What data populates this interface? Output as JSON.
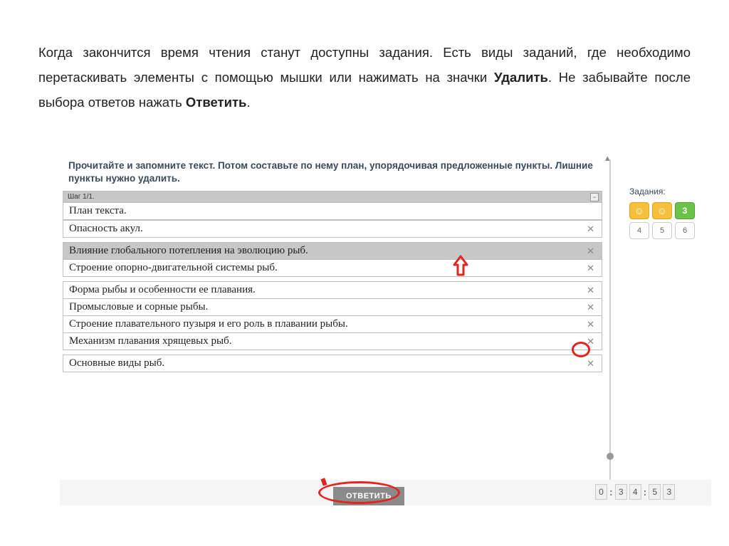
{
  "instruction": {
    "line1_a": "Когда закончится время чтения станут доступны задания. Есть виды заданий, где необходимо перетаскивать элементы с помощью мышки или нажимать на значки ",
    "bold1": "Удалить",
    "line1_b": ". Не забывайте после выбора ответов нажать ",
    "bold2": "Ответить",
    "line1_c": "."
  },
  "question": "Прочитайте и запомните текст. Потом составьте по нему план, упорядочивая предложенные пункты. Лишние пункты нужно удалить.",
  "step_label": "Шаг 1/1.",
  "plan_title": "План текста.",
  "items": [
    {
      "text": "Опасность акул.",
      "selected": false
    },
    {
      "text": "Влияние глобального потепления на эволюцию рыб.",
      "selected": true
    },
    {
      "text": "Строение опорно-двигательной системы рыб.",
      "selected": false
    },
    {
      "text": "Форма рыбы и особенности ее плавания.",
      "selected": false
    },
    {
      "text": "Промысловые и сорные рыбы.",
      "selected": false
    },
    {
      "text": "Строение плавательного пузыря и его роль в плавании рыбы.",
      "selected": false
    },
    {
      "text": "Механизм плавания хрящевых рыб.",
      "selected": false
    },
    {
      "text": "Основные виды рыб.",
      "selected": false
    }
  ],
  "delete_glyph": "✕",
  "sidebar": {
    "title": "Задания:",
    "row1": [
      {
        "kind": "yellow",
        "label": "☺"
      },
      {
        "kind": "yellow",
        "label": "☺"
      },
      {
        "kind": "green",
        "label": "3"
      }
    ],
    "row2": [
      {
        "kind": "plain",
        "label": "4"
      },
      {
        "kind": "plain",
        "label": "5"
      },
      {
        "kind": "plain",
        "label": "6"
      }
    ]
  },
  "answer_button": "ОТВЕТИТЬ",
  "timer_digits": [
    "0",
    ":",
    "3",
    "4",
    ":",
    "5",
    "3"
  ]
}
